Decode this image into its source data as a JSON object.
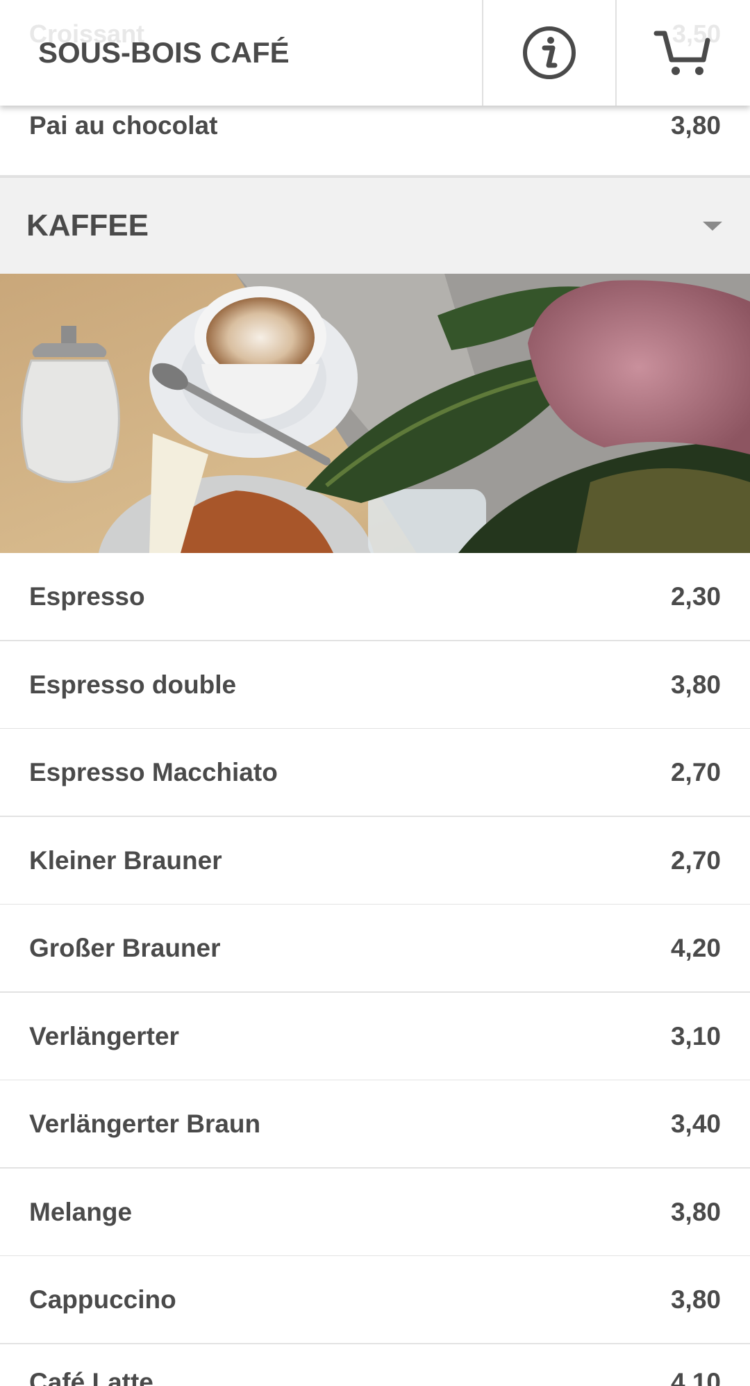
{
  "header": {
    "brand": "SOUS-BOIS CAFÉ",
    "info_icon": "info-circle-icon",
    "cart_icon": "shopping-cart-icon",
    "ghost_item": {
      "name": "Croissant",
      "price": "3,50"
    }
  },
  "items_before": [
    {
      "name": "Pai au chocolat",
      "price": "3,80"
    }
  ],
  "category": {
    "title": "KAFFEE",
    "toggle_icon": "caret-down-icon"
  },
  "items": [
    {
      "name": "Espresso",
      "price": "2,30"
    },
    {
      "name": "Espresso double",
      "price": "3,80"
    },
    {
      "name": "Espresso Macchiato",
      "price": "2,70"
    },
    {
      "name": "Kleiner Brauner",
      "price": "2,70"
    },
    {
      "name": "Großer Brauner",
      "price": "4,20"
    },
    {
      "name": "Verlängerter",
      "price": "3,10"
    },
    {
      "name": "Verlängerter Braun",
      "price": "3,40"
    },
    {
      "name": "Melange",
      "price": "3,80"
    },
    {
      "name": "Cappuccino",
      "price": "3,80"
    },
    {
      "name": "Café Latte",
      "price": "4,10"
    }
  ],
  "colors": {
    "text": "#4a4a4a",
    "category_bg": "#f1f1f1",
    "divider": "#e2e2e2"
  }
}
